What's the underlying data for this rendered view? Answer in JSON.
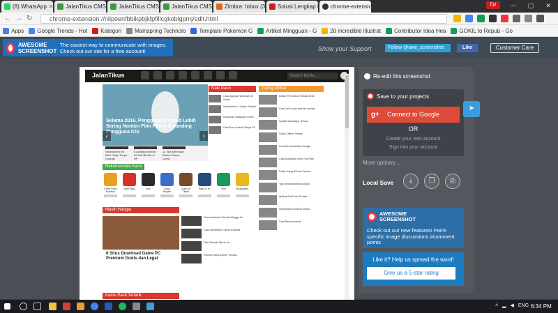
{
  "browser": {
    "tabs": [
      {
        "label": "(8) WhatsApp",
        "color": "#25d366"
      },
      {
        "label": "JalanTikus CMS",
        "color": "#3c9a3c"
      },
      {
        "label": "JalanTikus CMS",
        "color": "#3c9a3c"
      },
      {
        "label": "JalanTikus CMS",
        "color": "#3c9a3c"
      },
      {
        "label": "Zimbra: Inbox (36)",
        "color": "#e0681e"
      },
      {
        "label": "Solusi Lengkap Do",
        "color": "#d01c1c"
      },
      {
        "label": "chrome-extension",
        "color": "#333"
      }
    ],
    "profile": "Epi",
    "url": "chrome-extension://nlipoenfbbikpbjkfpfillcgkoblgpmj/edit.html",
    "bookmarks": [
      {
        "label": "Apps",
        "color": "#4a7fd6"
      },
      {
        "label": "Google Trends - Hot",
        "color": "#4285f4"
      },
      {
        "label": "Kategori",
        "color": "#d01c1c"
      },
      {
        "label": "Mainspring Technolo",
        "color": "#888"
      },
      {
        "label": "Template Pokemon G",
        "color": "#3367d6"
      },
      {
        "label": "Artikel Mingguan - G",
        "color": "#0f9d58"
      },
      {
        "label": "20 incredible illustrat",
        "color": "#f4b400"
      },
      {
        "label": "Contributor Idea Hea",
        "color": "#0f9d58"
      },
      {
        "label": "GOKIL to Repub - Go",
        "color": "#0f9d58"
      }
    ]
  },
  "app_header": {
    "logo_name": "AWESOME SCREENSHOT",
    "message": "The easiest way to communicate with images. Check out our site for a free account!",
    "show_support": "Show your Support",
    "follow": "Follow @awe_screenshot",
    "like": "Like",
    "customer_care": "Customer Care"
  },
  "screenshot": {
    "site_logo": "JalanTikus",
    "search_placeholder": "Search berita…",
    "hero_caption": "Selama 2016, Pengguna Android Lebih Sering Nonton Film Porno Dibanding Pengguna iOS",
    "thumbs": [
      "Smartphone Ini Bisa Hidup Tanpa Charger",
      "8 Aplikasi Android Ini WAJIB Ada di HP",
      "11 Tips Membuat Baterai Tahan Lama"
    ],
    "sections": {
      "naik_daun": "Naik Daun",
      "paling_dilihat": "Paling Dilihat",
      "rekomendasi": "Rekomendasi Kami",
      "masih_hangat": "Masih Hangat",
      "kamu_pasti": "Kamu Pasti Tertarik"
    },
    "apps": [
      "Kritik Fresh Nutrition",
      "JalanTikus",
      "Bolt",
      "Clash Royale",
      "Clash of Titans",
      "BBM LITE",
      "Vine",
      "Beaugame"
    ],
    "main_story": "6 Situs Download Game PC Premium Gratis dan Legal",
    "naik_items": [
      "Cara Upgrade Windows 10 Gratis",
      "Smartphone 4 Jutaan Terbaik",
      "Kumpulan Wallpaper Keren",
      "Cara Root Android Tanpa PC"
    ],
    "side_items": [
      "Daftar HP Android Terbaik 2016",
      "Cara Cek Kuota Internet Indosat",
      "Update WhatsApp Terbaru",
      "Game Offline Terbaik",
      "Cara Membuat Akun Google",
      "Cara Download Video YouTube",
      "Daftar Harga iPhone Terbaru",
      "Tips Hemat Baterai Android",
      "Aplikasi Edit Foto Terbaik",
      "Smartphone Android Murah",
      "Cara Reset Android"
    ],
    "hangat_items": [
      "Game Android Terbaik Minggu Ini",
      "Cara Bersihkan Cache Android",
      "Film Terbaik Tahun Ini",
      "Review Smartphone Terbaru"
    ]
  },
  "panel": {
    "reedit": "Re-edit this screenshot",
    "save_projects": "Save to your projects",
    "connect_google": "Connect to Google",
    "google_glyph": "g+",
    "or": "OR",
    "create_account": "Create your own account",
    "sign_in": "Sign into your account",
    "more_options": "More options...",
    "local_save": "Local Save",
    "promo_name": "AWESOME SCREENSHOT",
    "promo_text": "Check out our new features! Point-specific image discussions #comment points",
    "rate_question": "Like it? Help us spread the word!",
    "rate_button": "Give us a 5-star rating"
  },
  "taskbar": {
    "lang": "ENG",
    "time": "6:34 PM"
  }
}
